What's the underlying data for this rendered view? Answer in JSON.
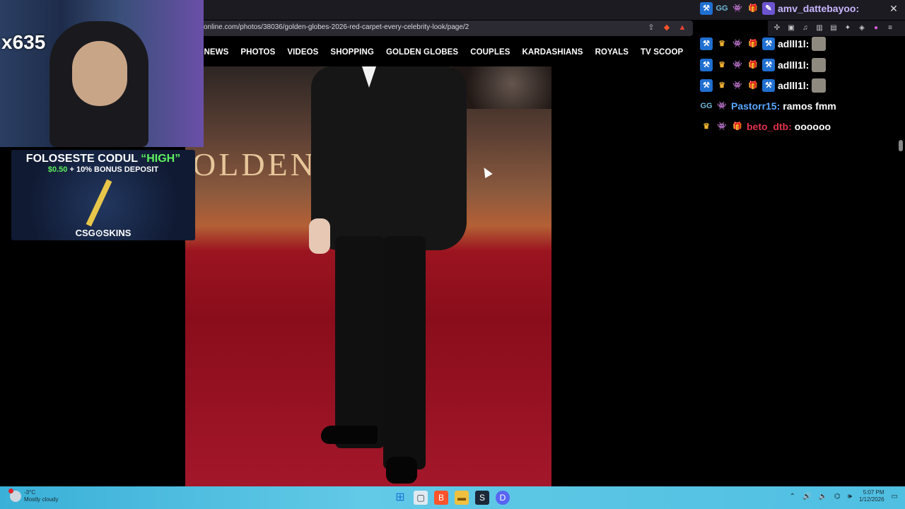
{
  "browser": {
    "url": "online.com/photos/38036/golden-globes-2026-red-carpet-every-celebrity-look/page/2",
    "close_label": "✕"
  },
  "site_nav": [
    "NEWS",
    "PHOTOS",
    "VIDEOS",
    "SHOPPING",
    "GOLDEN GLOBES",
    "COUPLES",
    "KARDASHIANS",
    "ROYALS",
    "TV SCOOP"
  ],
  "photo": {
    "backdrop_text": "OLDEN"
  },
  "webcam": {
    "tag": "x635"
  },
  "promo": {
    "line1_prefix": "FOLOSESTE CODUL ",
    "line1_code": "“HIGH”",
    "line2_amount": "$0.50",
    "line2_rest": " + 10% BONUS DEPOSIT",
    "brand": "CSG⊙SKINS"
  },
  "chat": {
    "messages": [
      {
        "user": "amv_dattebayoo:",
        "text": "",
        "color": "#c9b6ff"
      },
      {
        "user": "adlll1l:",
        "text": "",
        "color": "#ffffff"
      },
      {
        "user": "adlll1l:",
        "text": "",
        "color": "#ffffff"
      },
      {
        "user": "adlll1l:",
        "text": "",
        "color": "#ffffff"
      },
      {
        "user": "Pastorr15:",
        "text": "ramos fmm",
        "color": "#5aa7ff"
      },
      {
        "user": "beto_dtb:",
        "text": "oooooo",
        "color": "#e0334d"
      }
    ]
  },
  "taskbar": {
    "weather_temp": "-3°C",
    "weather_desc": "Mostly cloudy",
    "time": "5:07 PM",
    "date": "1/12/2026"
  }
}
